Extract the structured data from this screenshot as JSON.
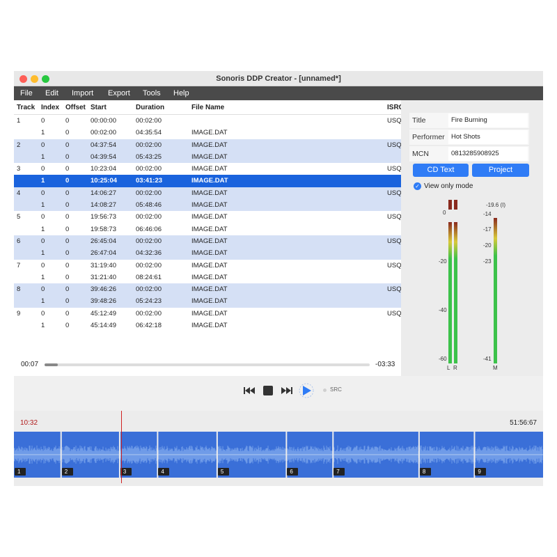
{
  "window": {
    "title": "Sonoris DDP Creator - [unnamed*]"
  },
  "menu": [
    "File",
    "Edit",
    "Import",
    "Export",
    "Tools",
    "Help"
  ],
  "table": {
    "headers": [
      "Track",
      "Index",
      "Offset",
      "Start",
      "Duration",
      "File Name",
      "ISRC"
    ],
    "rows": [
      {
        "track": "1",
        "index": "0",
        "offset": "0",
        "start": "00:00:00",
        "duration": "00:02:00",
        "file": "",
        "isrc": "USQ"
      },
      {
        "track": "",
        "index": "1",
        "offset": "0",
        "start": "00:02:00",
        "duration": "04:35:54",
        "file": "IMAGE.DAT",
        "isrc": ""
      },
      {
        "track": "2",
        "index": "0",
        "offset": "0",
        "start": "04:37:54",
        "duration": "00:02:00",
        "file": "IMAGE.DAT",
        "isrc": "USQ"
      },
      {
        "track": "",
        "index": "1",
        "offset": "0",
        "start": "04:39:54",
        "duration": "05:43:25",
        "file": "IMAGE.DAT",
        "isrc": ""
      },
      {
        "track": "3",
        "index": "0",
        "offset": "0",
        "start": "10:23:04",
        "duration": "00:02:00",
        "file": "IMAGE.DAT",
        "isrc": "USQ"
      },
      {
        "track": "",
        "index": "1",
        "offset": "0",
        "start": "10:25:04",
        "duration": "03:41:23",
        "file": "IMAGE.DAT",
        "isrc": ""
      },
      {
        "track": "4",
        "index": "0",
        "offset": "0",
        "start": "14:06:27",
        "duration": "00:02:00",
        "file": "IMAGE.DAT",
        "isrc": "USQ"
      },
      {
        "track": "",
        "index": "1",
        "offset": "0",
        "start": "14:08:27",
        "duration": "05:48:46",
        "file": "IMAGE.DAT",
        "isrc": ""
      },
      {
        "track": "5",
        "index": "0",
        "offset": "0",
        "start": "19:56:73",
        "duration": "00:02:00",
        "file": "IMAGE.DAT",
        "isrc": "USQ"
      },
      {
        "track": "",
        "index": "1",
        "offset": "0",
        "start": "19:58:73",
        "duration": "06:46:06",
        "file": "IMAGE.DAT",
        "isrc": ""
      },
      {
        "track": "6",
        "index": "0",
        "offset": "0",
        "start": "26:45:04",
        "duration": "00:02:00",
        "file": "IMAGE.DAT",
        "isrc": "USQ"
      },
      {
        "track": "",
        "index": "1",
        "offset": "0",
        "start": "26:47:04",
        "duration": "04:32:36",
        "file": "IMAGE.DAT",
        "isrc": ""
      },
      {
        "track": "7",
        "index": "0",
        "offset": "0",
        "start": "31:19:40",
        "duration": "00:02:00",
        "file": "IMAGE.DAT",
        "isrc": "USQ"
      },
      {
        "track": "",
        "index": "1",
        "offset": "0",
        "start": "31:21:40",
        "duration": "08:24:61",
        "file": "IMAGE.DAT",
        "isrc": ""
      },
      {
        "track": "8",
        "index": "0",
        "offset": "0",
        "start": "39:46:26",
        "duration": "00:02:00",
        "file": "IMAGE.DAT",
        "isrc": "USQ"
      },
      {
        "track": "",
        "index": "1",
        "offset": "0",
        "start": "39:48:26",
        "duration": "05:24:23",
        "file": "IMAGE.DAT",
        "isrc": ""
      },
      {
        "track": "9",
        "index": "0",
        "offset": "0",
        "start": "45:12:49",
        "duration": "00:02:00",
        "file": "IMAGE.DAT",
        "isrc": "USQ"
      },
      {
        "track": "",
        "index": "1",
        "offset": "0",
        "start": "45:14:49",
        "duration": "06:42:18",
        "file": "IMAGE.DAT",
        "isrc": ""
      }
    ],
    "selected_row": 5
  },
  "playback": {
    "elapsed": "00:07",
    "remaining": "-03:33",
    "progress": 0.04
  },
  "info": {
    "title_label": "Title",
    "title_value": "Fire Burning",
    "performer_label": "Performer",
    "performer_value": "Hot Shots",
    "mcn_label": "MCN",
    "mcn_value": "0813285908925",
    "cdtext_button": "CD Text",
    "project_button": "Project",
    "view_only_label": "View only mode",
    "view_only_checked": true
  },
  "meter": {
    "lr_scale": [
      "0",
      "-20",
      "-40",
      "-60"
    ],
    "m_scale": [
      "-14",
      "-17",
      "-20",
      "-23",
      "-41"
    ],
    "m_peak": "-19.6 (I)",
    "channel_l": "L",
    "channel_r": "R",
    "channel_m": "M",
    "level_l": 0.93,
    "level_r": 0.93,
    "level_m": 0.96
  },
  "transport": {
    "src_label": "SRC"
  },
  "timeline": {
    "playhead_time": "10:32",
    "total_time": "51:56:67",
    "playhead_fraction": 0.203,
    "tracks": [
      "1",
      "2",
      "3",
      "4",
      "5",
      "6",
      "7",
      "8",
      "9"
    ],
    "track_starts": [
      "00:00:00",
      "04:37:54",
      "10:23:04",
      "14:06:27",
      "19:56:73",
      "26:45:04",
      "31:19:40",
      "39:46:26",
      "45:12:49"
    ]
  },
  "colors": {
    "selection": "#1a63dd",
    "row_shade": "#d5e0f5",
    "waveform": "#3a6fd8",
    "waveform_highlight": "#6f9be8",
    "button": "#2f7cf6",
    "playhead": "#d02020",
    "meter_green": "#3cc24a",
    "meter_yellow": "#d8c93a",
    "meter_red": "#8a2a1e"
  },
  "icons": [
    "rewind-icon",
    "stop-icon",
    "fast-forward-icon",
    "play-icon",
    "checkbox-icon"
  ]
}
